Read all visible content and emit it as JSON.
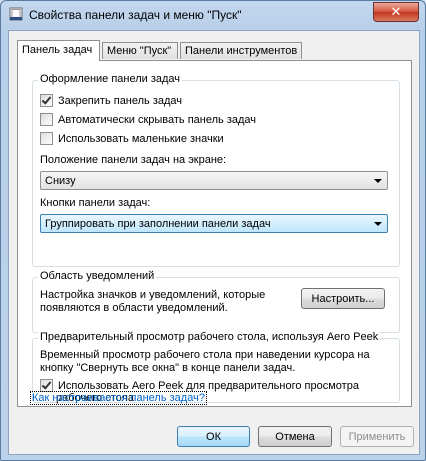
{
  "window": {
    "title": "Свойства панели задач и меню \"Пуск\"",
    "close_glyph": "✕"
  },
  "tabs": [
    {
      "label": "Панель задач"
    },
    {
      "label": "Меню \"Пуск\""
    },
    {
      "label": "Панели инструментов"
    }
  ],
  "appearance": {
    "legend": "Оформление панели задач",
    "lock": {
      "label": "Закрепить панель задач",
      "checked": true
    },
    "autohide": {
      "label": "Автоматически скрывать панель задач",
      "checked": false
    },
    "small_icons": {
      "label": "Использовать маленькие значки",
      "checked": false
    },
    "position_label": "Положение панели задач на экране:",
    "position_value": "Снизу",
    "buttons_label": "Кнопки панели задач:",
    "buttons_value": "Группировать при заполнении панели задач"
  },
  "notification": {
    "legend": "Область уведомлений",
    "description_line1": "Настройка значков и уведомлений, которые",
    "description_line2": "появляются в области уведомлений.",
    "customize_button": "Настроить..."
  },
  "aero_peek": {
    "legend": "Предварительный просмотр рабочего стола, используя Aero Peek",
    "description_line1": "Временный просмотр рабочего стола при наведении курсора на",
    "description_line2": "кнопку \"Свернуть все окна\" в конце панели задач.",
    "use_label_line1": "Использовать Aero Peek для предварительного просмотра",
    "use_label_line2": "рабочего стола",
    "use_checked": true
  },
  "help_link": "Как настраивается панель задач?",
  "footer": {
    "ok": "ОК",
    "cancel": "Отмена",
    "apply": "Применить"
  }
}
